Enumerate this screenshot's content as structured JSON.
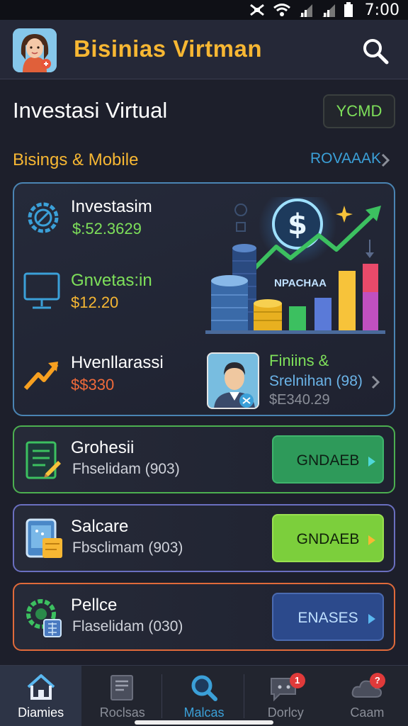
{
  "status_bar": {
    "time": "7:00"
  },
  "header": {
    "title": "Bisinias Virtman",
    "search_icon": "search-icon"
  },
  "page": {
    "title": "Investasi Virtual",
    "action_label": "YCMD"
  },
  "section": {
    "title": "Bisings & Mobile",
    "link_label": "ROVAAAK"
  },
  "overview": {
    "rows": [
      {
        "label": "Investasim",
        "value": "$:52.3629",
        "value_color": "#7ee05a",
        "icon": "gear-icon"
      },
      {
        "label": "Gnvetas:in",
        "value": "$12.20",
        "value_color": "#f7b733",
        "icon": "monitor-icon"
      },
      {
        "label": "Hvenllarassi",
        "value": "$$330",
        "value_color": "#f06a3a",
        "icon": "trend-arrow-icon"
      }
    ],
    "chart_label": "NPACHAA",
    "featured": {
      "title": "Finiins &",
      "subtitle": "Srelnihan (98)",
      "value": "$E340.29"
    }
  },
  "list": [
    {
      "title": "Grohesii",
      "subtitle": "Fhselidam (903)",
      "button": "GNDAEB",
      "border": "#4caf50",
      "btn_bg": "#2e9a5a",
      "btn_text": "#0d1f14",
      "tri": "#4fd8d8",
      "icon": "document-icon"
    },
    {
      "title": "Salcare",
      "subtitle": "Fbsclimam (903)",
      "button": "GNDAEB",
      "border": "#6a6fc0",
      "btn_bg": "#7ccf3c",
      "btn_text": "#10210a",
      "tri": "#f7b733",
      "icon": "tablet-icon"
    },
    {
      "title": "Pellce",
      "subtitle": "Flaselidam (030)",
      "button": "ENASES",
      "border": "#e06a3a",
      "btn_bg": "#2c4a8c",
      "btn_text": "#bfe0ff",
      "tri": "#5ab8f0",
      "icon": "gear-chip-icon"
    }
  ],
  "bottom_nav": [
    {
      "label": "Diamies",
      "icon": "home-icon",
      "badge": ""
    },
    {
      "label": "Roclsas",
      "icon": "document-stack-icon",
      "badge": ""
    },
    {
      "label": "Malcas",
      "icon": "search-icon",
      "badge": ""
    },
    {
      "label": "Dorlcy",
      "icon": "chat-icon",
      "badge": "1"
    },
    {
      "label": "Caam",
      "icon": "cloud-icon",
      "badge": "?"
    }
  ]
}
